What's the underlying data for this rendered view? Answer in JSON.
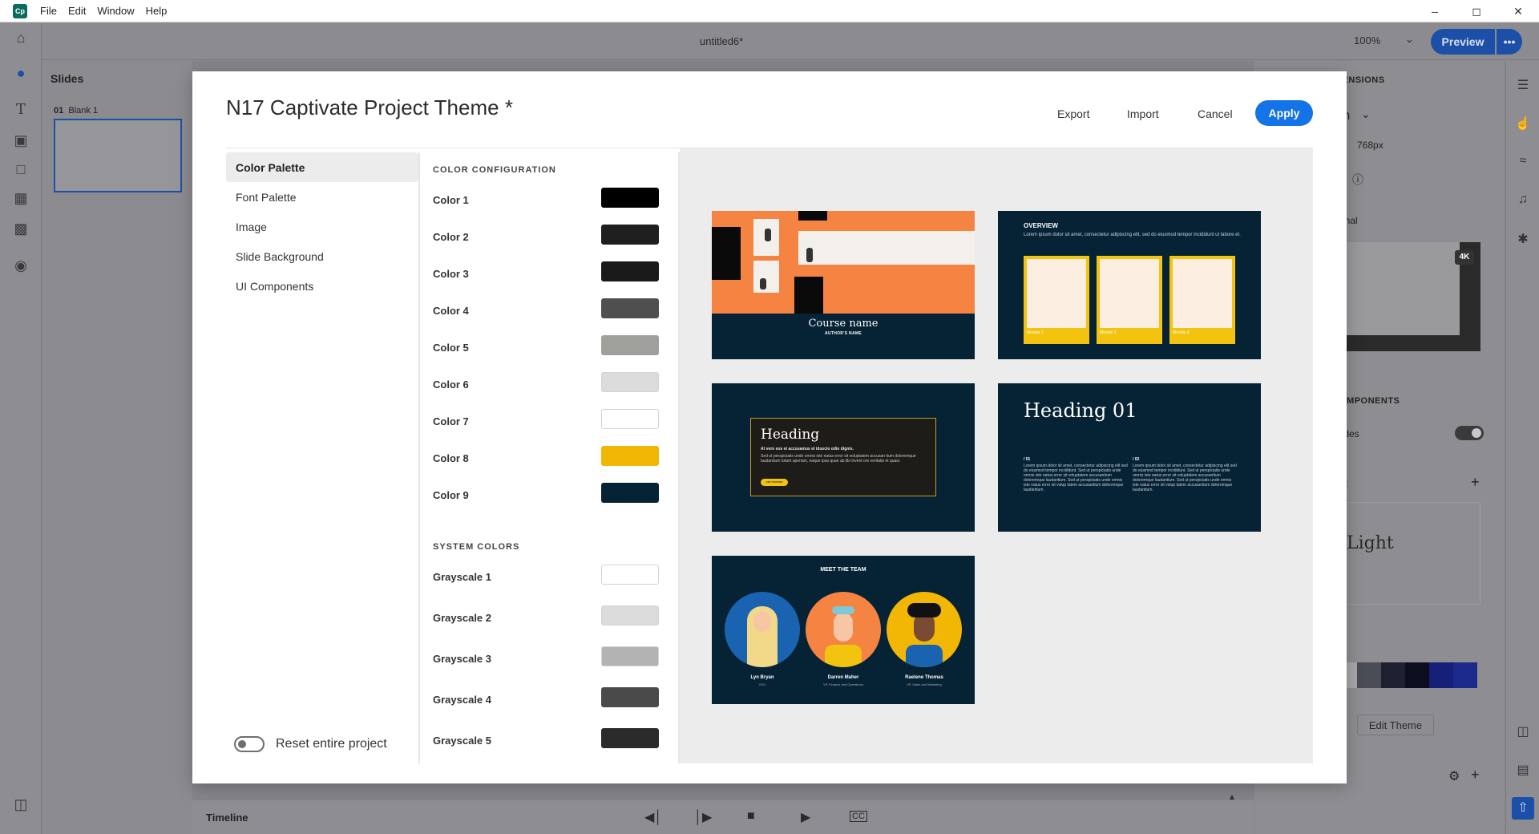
{
  "menubar": {
    "app_logo": "Cp",
    "items": [
      "File",
      "Edit",
      "Window",
      "Help"
    ]
  },
  "background": {
    "doc_title": "untitled6*",
    "zoom": "100%",
    "preview_label": "Preview",
    "more_label": "•••",
    "slides_header": "Slides",
    "slide_number": "01",
    "slide_name": "Blank 1",
    "timeline_label": "Timeline",
    "right_panel": {
      "dimensions_heading": "IENSIONS",
      "dim_select": "m",
      "height_value": "768px",
      "optional_text": "onal",
      "badge_4k": "4K",
      "components_heading": "OMPONENTS",
      "slides_toggle_label": "lides",
      "light_heading": "ht",
      "theme_name": "Light",
      "edit_theme": "Edit Theme",
      "theme_swatches": [
        "#a8a8ab",
        "#4a4c56",
        "#1c2030",
        "#0a0e1f",
        "#162078",
        "#1c2a8c"
      ]
    }
  },
  "modal": {
    "title": "N17 Captivate Project Theme",
    "asterisk": "*",
    "actions": {
      "export": "Export",
      "import": "Import",
      "cancel": "Cancel",
      "apply": "Apply"
    },
    "nav": [
      {
        "label": "Color Palette",
        "active": true
      },
      {
        "label": "Font Palette",
        "active": false
      },
      {
        "label": "Image",
        "active": false
      },
      {
        "label": "Slide Background",
        "active": false
      },
      {
        "label": "UI Components",
        "active": false
      }
    ],
    "reset_label": "Reset entire project",
    "color_config_heading": "COLOR CONFIGURATION",
    "colors": [
      {
        "label": "Color 1",
        "hex": "#000000"
      },
      {
        "label": "Color 2",
        "hex": "#1f1f1f"
      },
      {
        "label": "Color 3",
        "hex": "#1a1a1a"
      },
      {
        "label": "Color 4",
        "hex": "#4f4f4f"
      },
      {
        "label": "Color 5",
        "hex": "#9f9f9b"
      },
      {
        "label": "Color 6",
        "hex": "#dcdcdc"
      },
      {
        "label": "Color 7",
        "hex": "#ffffff"
      },
      {
        "label": "Color 8",
        "hex": "#f2b705"
      },
      {
        "label": "Color 9",
        "hex": "#062235"
      }
    ],
    "system_colors_heading": "SYSTEM COLORS",
    "system_colors": [
      {
        "label": "Grayscale 1",
        "hex": "#ffffff"
      },
      {
        "label": "Grayscale 2",
        "hex": "#dcdcdc"
      },
      {
        "label": "Grayscale 3",
        "hex": "#b3b3b3"
      },
      {
        "label": "Grayscale 4",
        "hex": "#4a4a4a"
      },
      {
        "label": "Grayscale 5",
        "hex": "#2b2b2b"
      }
    ],
    "previews": {
      "t1": {
        "title": "Course name",
        "subtitle": "AUTHOR'S NAME"
      },
      "t2": {
        "heading": "OVERVIEW",
        "text": "Lorem ipsum dolor sit amet, consectetur adipiscing elit, sed do eiusmod tempor incididunt ut labore et.",
        "modules": [
          "Module 1",
          "Module 2",
          "Module 3"
        ]
      },
      "t3": {
        "heading": "Heading",
        "bold_line": "At vero eos et accusamus et iduscio odio dignis.",
        "body": "Sed ut perspiciatis unde omnis iste natus error sit voluptatem accusan tium doloremque laudantium totam aperiam, eaque ipsa quae ab illo invent ore veritatis et quasi.",
        "button": "GET STARTED"
      },
      "t4": {
        "heading": "Heading 01",
        "col1_num": "/ 01",
        "col2_num": "/ 02",
        "col_text": "Lorem ipsum dolor sit amet, consectetur adipiscing elit sed do eiusmod tempor incididunt. Sed ut perspiciatis unde omnis iste natus error sit voluptatem accusantium doloremque laudantium. Sed ut perspiciatis unde omnis iste natus error sit volup tatem accusantium doloremque laudantium."
      },
      "t5": {
        "heading": "MEET THE TEAM",
        "members": [
          {
            "name": "Lyn Bryan",
            "role": "CEO"
          },
          {
            "name": "Darren Maher",
            "role": "VP, Finance and Operations"
          },
          {
            "name": "Raelene Thomas",
            "role": "VP, Sales and Marketing"
          }
        ]
      }
    }
  }
}
